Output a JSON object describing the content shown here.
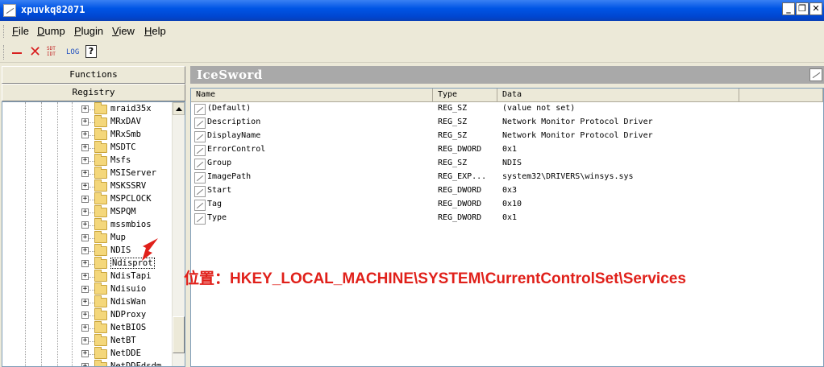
{
  "window": {
    "title": "xpuvkq82071"
  },
  "window_buttons": {
    "minimize": "_",
    "restore": "❐",
    "close": "✕"
  },
  "menu": [
    {
      "mn": "F",
      "rest": "ile"
    },
    {
      "mn": "D",
      "rest": "ump"
    },
    {
      "mn": "P",
      "rest": "lugin"
    },
    {
      "mn": "V",
      "rest": "iew"
    },
    {
      "mn": "H",
      "rest": "elp"
    }
  ],
  "toolbar": {
    "close_label": "✕",
    "sdt_top": "SDT",
    "sdt_bottom": "IDT",
    "log_label": "LOG",
    "help_label": "?"
  },
  "left_panel": {
    "functions_label": "Functions",
    "registry_label": "Registry",
    "tree_items": [
      {
        "label": "mraid35x",
        "expander": "+"
      },
      {
        "label": "MRxDAV",
        "expander": "+"
      },
      {
        "label": "MRxSmb",
        "expander": "+"
      },
      {
        "label": "MSDTC",
        "expander": "+"
      },
      {
        "label": "Msfs",
        "expander": "+"
      },
      {
        "label": "MSIServer",
        "expander": "+"
      },
      {
        "label": "MSKSSRV",
        "expander": "+"
      },
      {
        "label": "MSPCLOCK",
        "expander": "+"
      },
      {
        "label": "MSPQM",
        "expander": "+"
      },
      {
        "label": "mssmbios",
        "expander": "+"
      },
      {
        "label": "Mup",
        "expander": "+"
      },
      {
        "label": "NDIS",
        "expander": "+"
      },
      {
        "label": "Ndisprot",
        "expander": "+"
      },
      {
        "label": "NdisTapi",
        "expander": "+"
      },
      {
        "label": "Ndisuio",
        "expander": "+"
      },
      {
        "label": "NdisWan",
        "expander": "+"
      },
      {
        "label": "NDProxy",
        "expander": "+"
      },
      {
        "label": "NetBIOS",
        "expander": "+"
      },
      {
        "label": "NetBT",
        "expander": "+"
      },
      {
        "label": "NetDDE",
        "expander": "+"
      },
      {
        "label": "NetDDEdsdm",
        "expander": "+"
      }
    ]
  },
  "right_panel": {
    "header_title": "IceSword",
    "columns": {
      "name": "Name",
      "type": "Type",
      "data": "Data"
    },
    "rows": [
      {
        "name": "(Default)",
        "type": "REG_SZ",
        "data": "(value not set)"
      },
      {
        "name": "Description",
        "type": "REG_SZ",
        "data": "Network Monitor Protocol Driver"
      },
      {
        "name": "DisplayName",
        "type": "REG_SZ",
        "data": "Network Monitor Protocol Driver"
      },
      {
        "name": "ErrorControl",
        "type": "REG_DWORD",
        "data": "0x1"
      },
      {
        "name": "Group",
        "type": "REG_SZ",
        "data": "NDIS"
      },
      {
        "name": "ImagePath",
        "type": "REG_EXP...",
        "data": "system32\\DRIVERS\\winsys.sys"
      },
      {
        "name": "Start",
        "type": "REG_DWORD",
        "data": "0x3"
      },
      {
        "name": "Tag",
        "type": "REG_DWORD",
        "data": "0x10"
      },
      {
        "name": "Type",
        "type": "REG_DWORD",
        "data": "0x1"
      }
    ]
  },
  "annotation": {
    "text": "位置：HKEY_LOCAL_MACHINE\\SYSTEM\\CurrentControlSet\\Services",
    "color": "#e0201a"
  }
}
